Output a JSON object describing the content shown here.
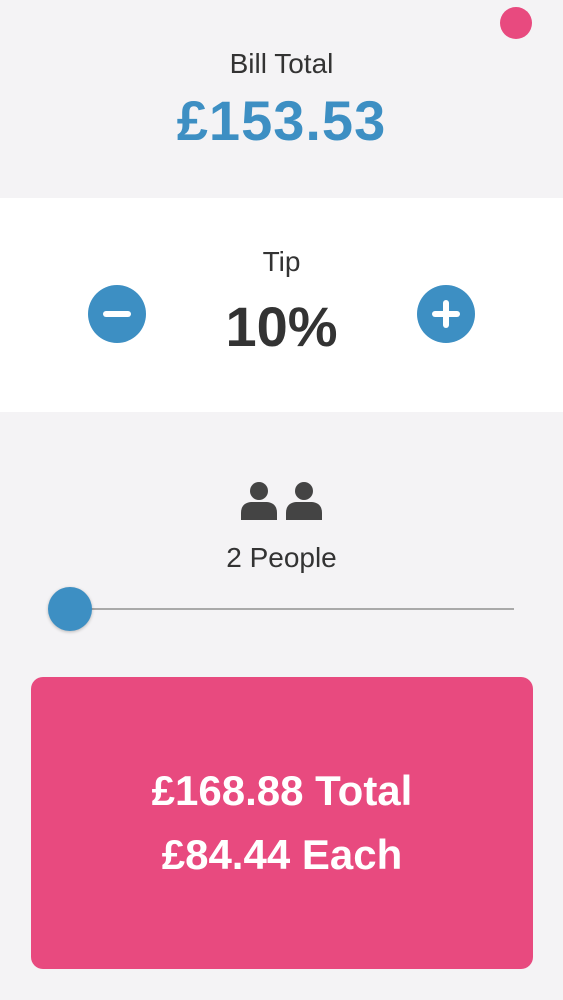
{
  "status": {
    "indicator_color": "#e84a7f"
  },
  "bill": {
    "label": "Bill Total",
    "amount": "£153.53"
  },
  "tip": {
    "label": "Tip",
    "value": "10%",
    "decrease_icon": "minus-circle-icon",
    "increase_icon": "plus-circle-icon"
  },
  "people": {
    "icon": "people-icon",
    "label": "2 People",
    "slider_count": 2
  },
  "result": {
    "total_text": "£168.88 Total",
    "each_text": "£84.44 Each"
  },
  "colors": {
    "accent": "#3d8fc3",
    "highlight": "#e84a7f",
    "background": "#f4f3f5",
    "panel": "#ffffff"
  }
}
